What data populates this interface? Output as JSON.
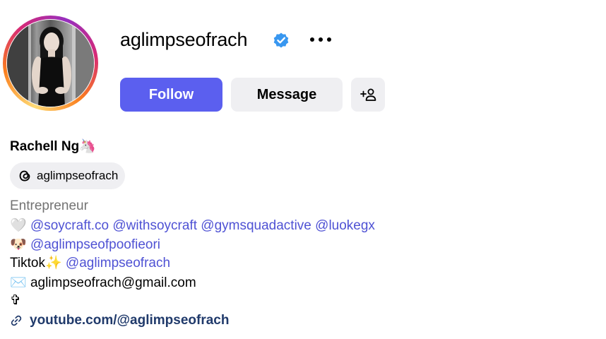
{
  "profile": {
    "username": "aglimpseofrach",
    "more_icon": "more-horizontal-icon",
    "verified_icon": "verified-badge-icon"
  },
  "actions": {
    "follow_label": "Follow",
    "message_label": "Message",
    "suggest_icon": "add-person-icon"
  },
  "bio": {
    "full_name": "Rachell Ng🦄",
    "threads_handle": "aglimpseofrach",
    "category": "Entrepreneur",
    "line1_emoji": "🤍",
    "line1_mentions": [
      "@soycraft.co",
      "@withsoycraft",
      "@gymsquadactive",
      "@luokegx"
    ],
    "line2_emoji": "🐶",
    "line2_mention": "@aglimpseofpoofieori",
    "line3_prefix": "Tiktok✨",
    "line3_mention": "@aglimpseofrach",
    "line4_emoji": "✉️",
    "email": "aglimpseofrach@gmail.com",
    "line5": "✞",
    "link": "youtube.com/@aglimpseofrach"
  },
  "colors": {
    "accent": "#5b5fef",
    "mention": "#4f52d4",
    "link": "#203a6b",
    "verified": "#3897f0",
    "button_bg": "#efeff2"
  }
}
